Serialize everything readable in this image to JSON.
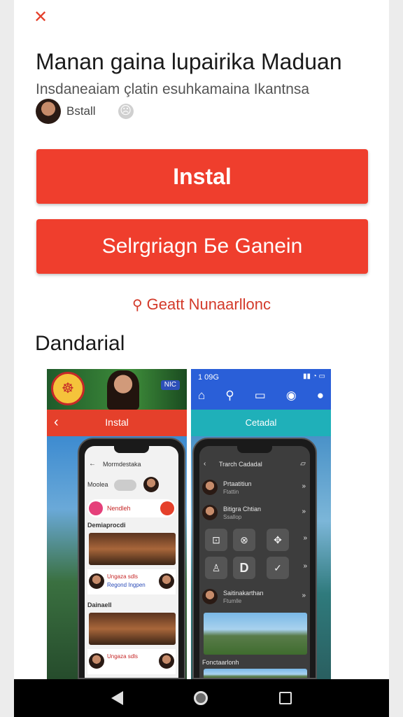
{
  "header": {
    "close_icon": "close-icon"
  },
  "app": {
    "title": "Manan gaina lupairika Maduan",
    "subtitle": "Insdaneaiam çlatin esuhkamaina Ikantnsa",
    "developer": "Bstall"
  },
  "buttons": {
    "install": "Instal",
    "secondary": "Selrgriagn Бe Ganein"
  },
  "link": {
    "icon": "key-icon",
    "text": "Geatt Nunaarllonc"
  },
  "section": {
    "title": "Dandarial"
  },
  "screenshot_left": {
    "tag": "NIC",
    "bar_label": "Instal",
    "screen_title": "Mormdestaka",
    "row1": "Moolea",
    "row2": "Nendleh",
    "heading1": "Demiaprocdi",
    "card1_line1": "Ungaza sdls",
    "card1_line2": "Regond Ingpen",
    "heading2": "Dainaell",
    "card2_line1": "Ungaza sdls"
  },
  "screenshot_right": {
    "time": "1 09G",
    "bar_label": "Cetadal",
    "screen_title": "Trarch Cadadal",
    "item1_title": "Prtaatitiun",
    "item1_sub": "Ftattin",
    "item2_title": "Bitigra Chtian",
    "item2_sub": "Ssallop",
    "item3_title": "Saitinakarthan",
    "item3_sub": "Ftumlle",
    "footer_label": "Fonctaarlonh"
  },
  "colors": {
    "accent": "#ef3e2d",
    "blue": "#2a5fd8",
    "teal": "#1fb0b9"
  }
}
